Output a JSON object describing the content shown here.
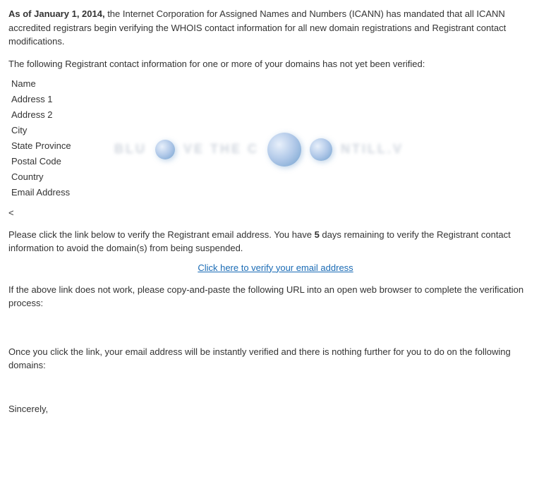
{
  "intro": {
    "bold_date": "As of January 1, 2014,",
    "text": " the Internet Corporation for Assigned Names and Numbers (ICANN) has mandated that all ICANN accredited registrars begin verifying the WHOIS contact information for all new domain registrations and Registrant contact modifications.",
    "subtitle": "The following Registrant contact information for one or more of your domains has not yet been verified:"
  },
  "contact_fields": [
    {
      "label": "Name"
    },
    {
      "label": "Address 1"
    },
    {
      "label": "Address 2"
    },
    {
      "label": "City"
    },
    {
      "label": "State Province"
    },
    {
      "label": "Postal Code"
    },
    {
      "label": "Country"
    },
    {
      "label": "Email Address"
    }
  ],
  "back_link": "<",
  "verify_text_1": "Please click the link below to verify the Registrant email address. You have ",
  "verify_bold": "5",
  "verify_text_2": " days remaining to verify the Registrant contact information to avoid the domain(s) from being suspended.",
  "verify_link_label": "Click here to verify your email address",
  "verify_link_href": "#",
  "fallback_text": "If the above link does not work, please copy-and-paste the following URL into an open web browser to complete the verification process:",
  "once_text": "Once you click the link, your email address will be instantly verified and there is nothing further for you to do on the following domains:",
  "sincerely": "Sincerely,"
}
